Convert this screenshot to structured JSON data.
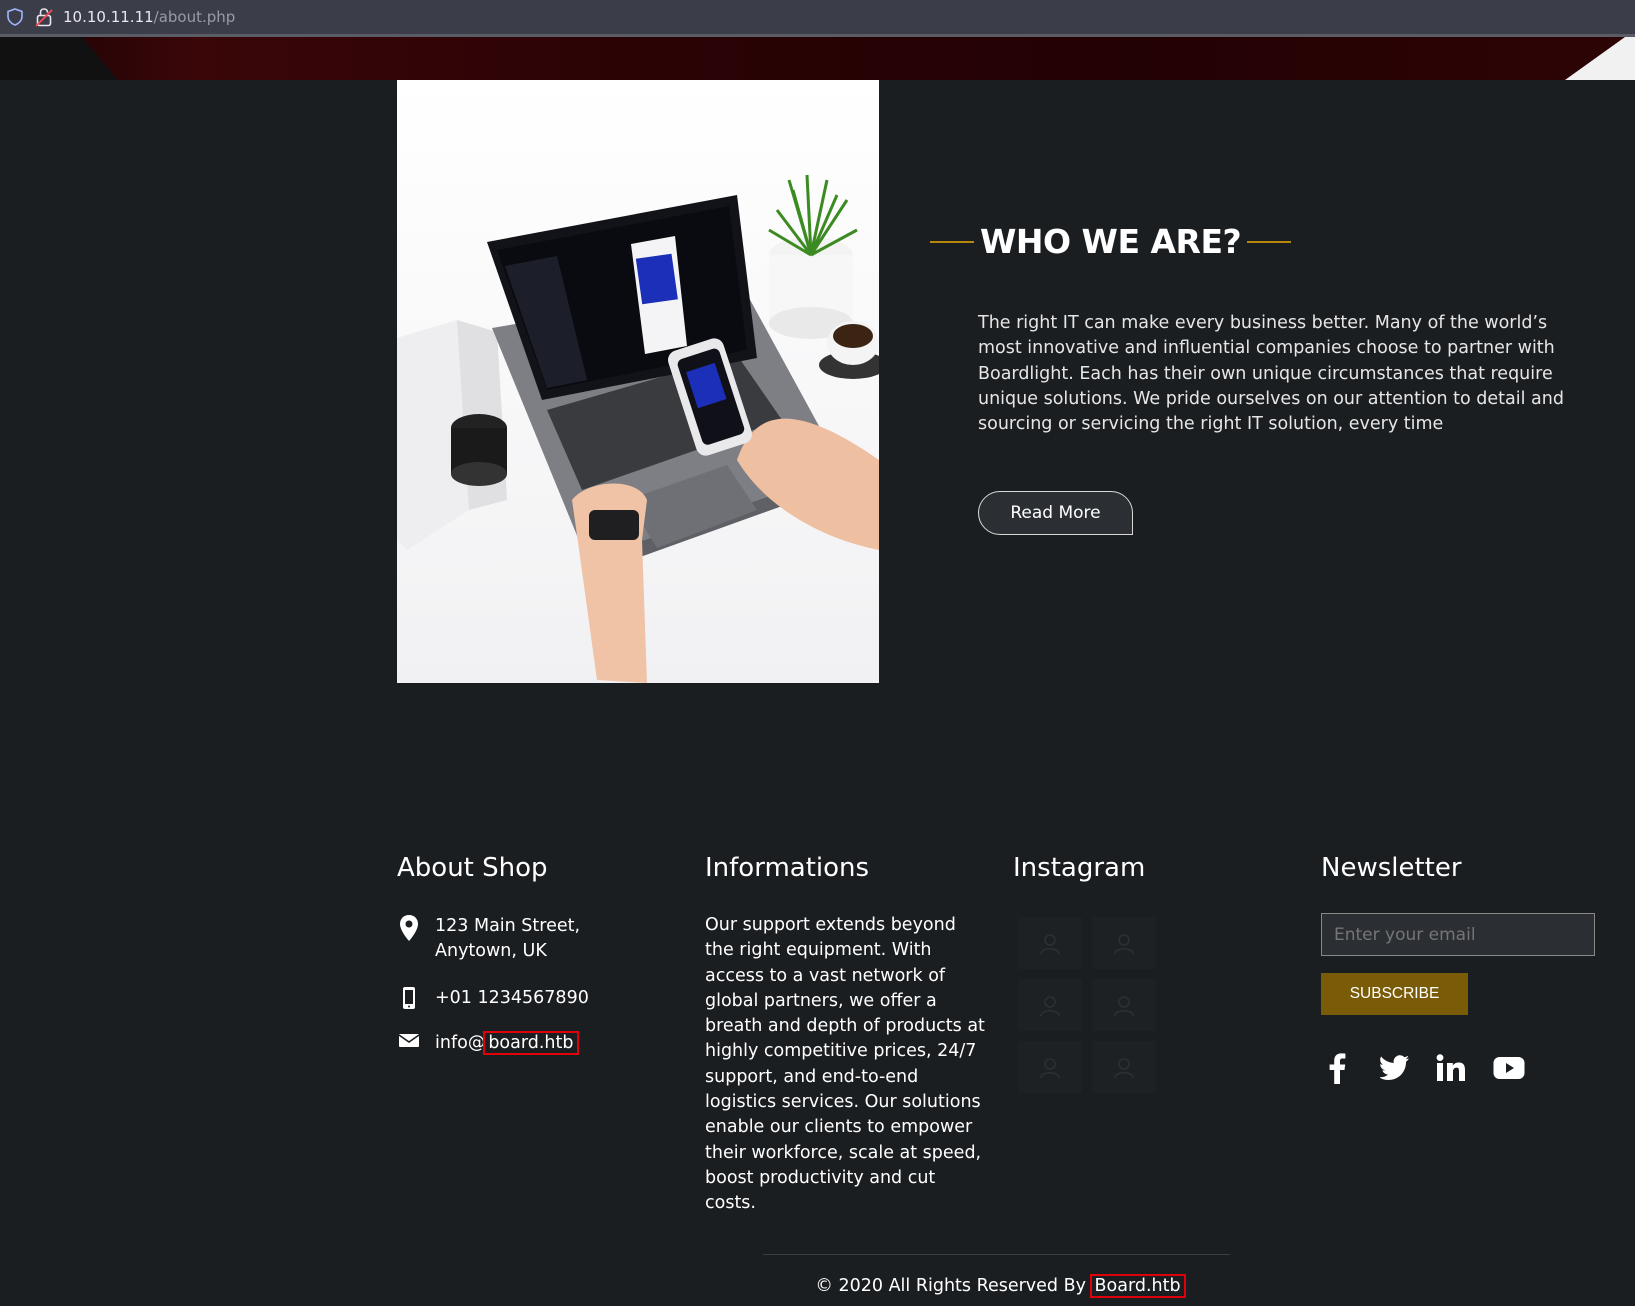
{
  "browser": {
    "url_host": "10.10.11.11",
    "url_path": "/about.php"
  },
  "about": {
    "heading": "WHO WE ARE?",
    "paragraph": "The right IT can make every business better. Many of the world’s most innovative and influential companies choose to partner with Boardlight. Each has their own unique circumstances that require unique solutions. We pride ourselves on our attention to detail and sourcing or servicing the right IT solution, every time",
    "button_label": "Read More"
  },
  "footer": {
    "about_shop": {
      "title": "About Shop",
      "address_line1": "123 Main Street,",
      "address_line2": "Anytown, UK",
      "phone": "+01 1234567890",
      "email_prefix": "info@",
      "email_domain": "board.htb"
    },
    "informations": {
      "title": "Informations",
      "text": "Our support extends beyond the right equipment. With access to a vast network of global partners, we offer a breath and depth of products at highly competitive prices, 24/7 support, and end-to-end logistics services. Our solutions enable our clients to empower their workforce, scale at speed, boost productivity and cut costs."
    },
    "instagram": {
      "title": "Instagram"
    },
    "newsletter": {
      "title": "Newsletter",
      "placeholder": "Enter your email",
      "button_label": "SUBSCRIBE",
      "social_icons": [
        "facebook-icon",
        "twitter-icon",
        "linkedin-icon",
        "youtube-icon"
      ]
    },
    "copyright_prefix": "© 2020 All Rights Reserved By ",
    "copyright_brand": "Board.htb"
  },
  "colors": {
    "accent_gold": "#b8860b",
    "subscribe_bg": "#7a5b07",
    "highlight_red": "#e0000a",
    "page_bg": "#1b1e21"
  }
}
